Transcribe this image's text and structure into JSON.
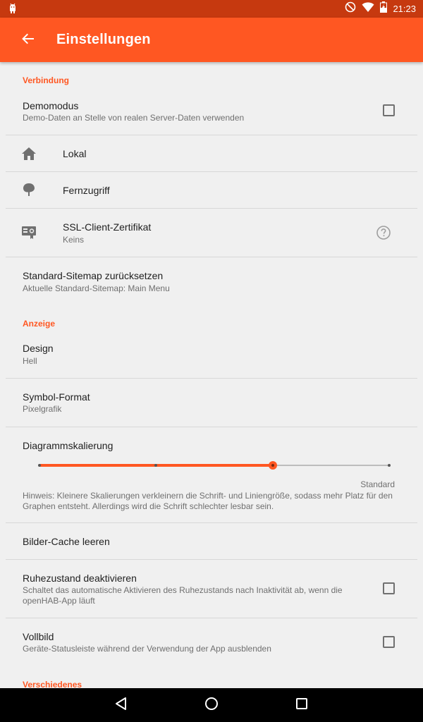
{
  "status_bar": {
    "time": "21:23",
    "icons": [
      "android-debug-icon",
      "do-not-disturb-icon",
      "wifi-icon",
      "battery-charging-icon"
    ]
  },
  "app_bar": {
    "title": "Einstellungen",
    "back_icon": "arrow-back-icon",
    "color": "#ff5722",
    "statusbar_color": "#c6390f"
  },
  "sections": {
    "connection": {
      "header": "Verbindung",
      "demo_mode": {
        "title": "Demomodus",
        "summary": "Demo-Daten an Stelle von realen Server-Daten verwenden",
        "checked": false
      },
      "local": {
        "title": "Lokal",
        "icon": "home-icon"
      },
      "remote": {
        "title": "Fernzugriff",
        "icon": "tree-icon"
      },
      "ssl": {
        "title": "SSL-Client-Zertifikat",
        "summary": "Keins",
        "icon": "certificate-icon",
        "help_icon": "help-circle-icon"
      },
      "sitemap": {
        "title": "Standard-Sitemap zurücksetzen",
        "summary": "Aktuelle Standard-Sitemap: Main Menu"
      }
    },
    "display": {
      "header": "Anzeige",
      "design": {
        "title": "Design",
        "summary": "Hell"
      },
      "icon_format": {
        "title": "Symbol-Format",
        "summary": "Pixelgrafik"
      },
      "chart_scaling": {
        "title": "Diagrammskalierung",
        "steps": 4,
        "selected_index": 2,
        "value_label": "Standard",
        "hint_line1": "Hinweis: Kleinere Skalierungen verkleinern die Schrift- und Liniengröße, sodass mehr Platz für den",
        "hint_line2": "Graphen entsteht. Allerdings wird die Schrift schlechter lesbar sein."
      },
      "clear_cache": {
        "title": "Bilder-Cache leeren"
      },
      "screen_lock": {
        "title": "Ruhezustand deaktivieren",
        "summary_line1": "Schaltet das automatische Aktivieren des Ruhezustands nach Inaktivität ab, wenn die",
        "summary_line2": "openHAB-App läuft",
        "checked": false
      },
      "fullscreen": {
        "title": "Vollbild",
        "summary": "Geräte-Statusleiste während der Verwendung der App ausblenden",
        "checked": false
      }
    },
    "misc": {
      "header": "Verschiedenes"
    }
  },
  "nav_bar": {
    "back_icon": "nav-back-icon",
    "home_icon": "nav-home-icon",
    "recents_icon": "nav-recents-icon"
  }
}
